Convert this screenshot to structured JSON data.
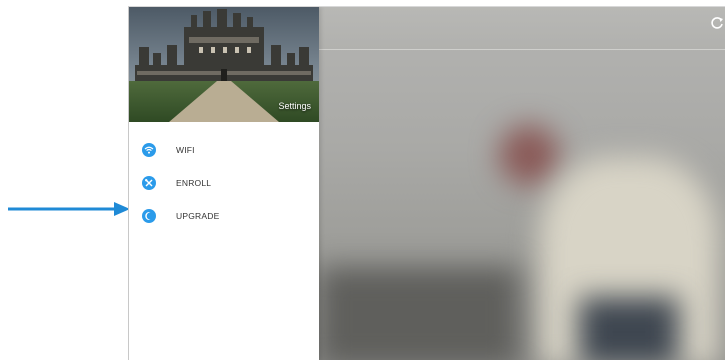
{
  "drawer": {
    "header_title": "Settings",
    "items": [
      {
        "label": "WIFI",
        "icon": "wifi-icon"
      },
      {
        "label": "ENROLL",
        "icon": "tools-icon"
      },
      {
        "label": "UPGRADE",
        "icon": "upgrade-icon"
      }
    ]
  },
  "annotation": {
    "arrow_target": "UPGRADE"
  },
  "colors": {
    "accent": "#2b9bea",
    "arrow": "#1f8ad6",
    "label_text": "#333333"
  },
  "toolbar": {
    "refresh_icon": "refresh-icon"
  }
}
